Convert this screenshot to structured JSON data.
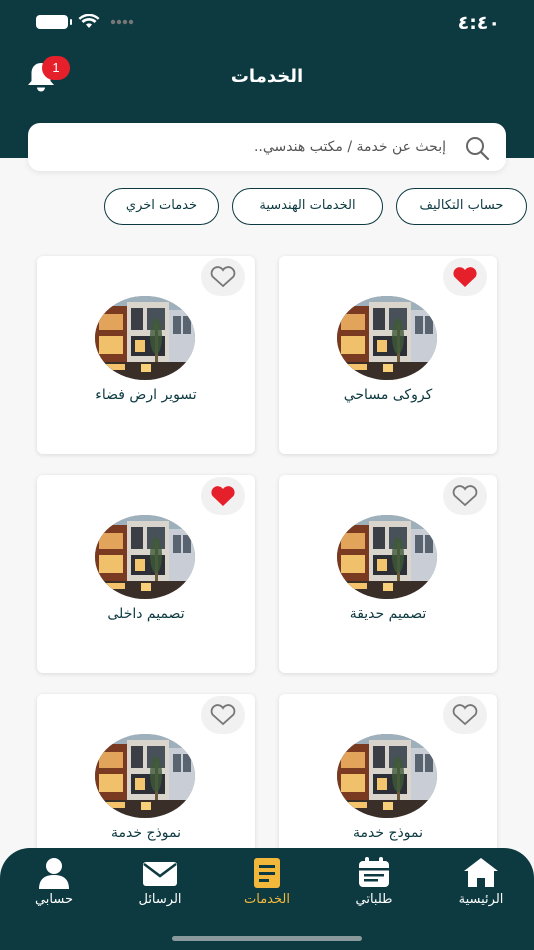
{
  "status": {
    "time": "٤:٤٠"
  },
  "header": {
    "title": "الخدمات",
    "notification_count": "1"
  },
  "search": {
    "placeholder": "إبحث عن خدمة / مكتب هندسي.."
  },
  "chips": [
    "حساب التكاليف",
    "الخدمات الهندسية",
    "خدمات اخري"
  ],
  "services": [
    {
      "label": "كروكى مساحي",
      "favorite": true
    },
    {
      "label": "تسوير ارض فضاء",
      "favorite": false
    },
    {
      "label": "تصميم حديقة",
      "favorite": false
    },
    {
      "label": "تصميم داخلى",
      "favorite": true
    },
    {
      "label": "نموذج خدمة",
      "favorite": false
    },
    {
      "label": "نموذج خدمة",
      "favorite": false
    }
  ],
  "nav": {
    "items": [
      {
        "label": "الرئيسية",
        "icon": "home-icon"
      },
      {
        "label": "طلباتي",
        "icon": "calendar-icon"
      },
      {
        "label": "الخدمات",
        "icon": "services-icon",
        "active": true
      },
      {
        "label": "الرسائل",
        "icon": "envelope-icon"
      },
      {
        "label": "حسابي",
        "icon": "user-icon"
      }
    ]
  },
  "colors": {
    "primary": "#0d3a41",
    "accent": "#f2b83b",
    "heart": "#e5202a",
    "background": "#f7f7f7"
  }
}
